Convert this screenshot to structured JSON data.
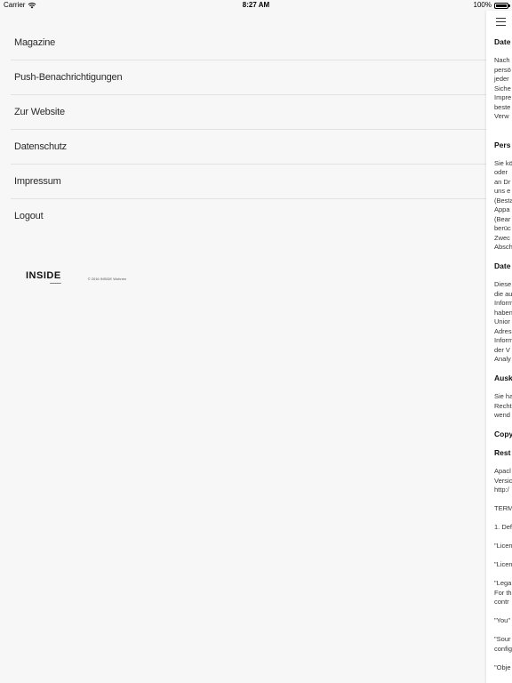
{
  "status_bar": {
    "carrier": "Carrier",
    "time": "8:27 AM",
    "battery": "100%",
    "battery_level": 1.0
  },
  "menu": {
    "items": [
      {
        "label": "Magazine"
      },
      {
        "label": "Push-Benachrichtigungen"
      },
      {
        "label": "Zur Website"
      },
      {
        "label": "Datenschutz"
      },
      {
        "label": "Impressum"
      },
      {
        "label": "Logout"
      }
    ]
  },
  "footer": {
    "logo": "INSIDE",
    "copyright": "© 2016 INSIDE Wohnen"
  },
  "panel": {
    "menu_icon": "hamburger-menu-icon",
    "doc": {
      "h1": "Date",
      "p1": [
        "Nach",
        "persö",
        "jeder",
        "Siche",
        "Impre",
        "beste",
        "Verw"
      ],
      "h2": "Pers",
      "p2": [
        "Sie kö",
        "oder",
        "an Dr",
        "uns e",
        "(Besta",
        "Appa",
        "(Bear",
        "berüc",
        "Zwec",
        "Absch"
      ],
      "h3": "Date",
      "p3": [
        "Diese",
        "die au",
        "Inform",
        "haben",
        "Unior",
        "Adres",
        "Inform",
        "der V",
        "Analy"
      ],
      "h4": "Ausk",
      "p4": [
        "Sie ha",
        "Recht",
        "wend"
      ],
      "h5": "Copy",
      "h6": "Rest",
      "p5": [
        "Apacl",
        "Versic",
        "http:/"
      ],
      "t1": "TERM",
      "t2": "1. Def",
      "t3": "\"Licen",
      "t4": "\"Licen",
      "p6": [
        "\"Lega",
        "For th",
        "contr"
      ],
      "t5": "\"You\"",
      "p7": [
        "\"Sour",
        "config"
      ],
      "t6": "\"Obje"
    }
  }
}
